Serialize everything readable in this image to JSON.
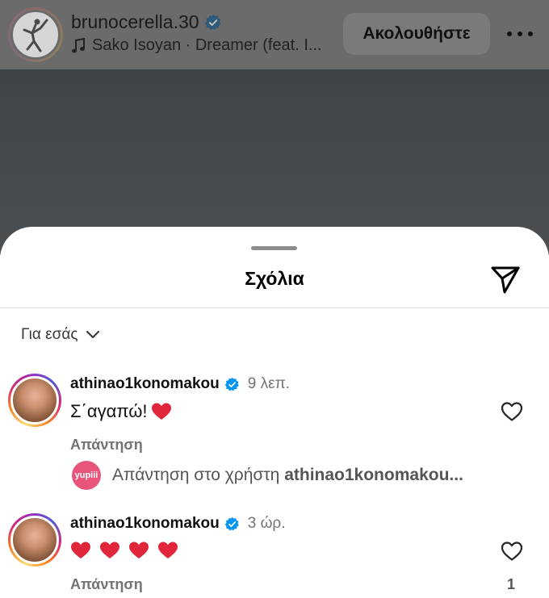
{
  "post": {
    "username": "brunocerella.30",
    "music": "Sako Isoyan · Dreamer (feat. I...",
    "follow_label": "Ακολουθήστε"
  },
  "sheet": {
    "title": "Σχόλια",
    "sort_label": "Για εσάς"
  },
  "comments": [
    {
      "username": "athinao1konomakou",
      "time": "9 λεπ.",
      "text": "Σ΄αγαπώ!",
      "hearts": 1,
      "reply_label": "Απάντηση",
      "likes": ""
    },
    {
      "username": "athinao1konomakou",
      "time": "3 ώρ.",
      "text": "",
      "hearts": 4,
      "reply_label": "Απάντηση",
      "likes": "1"
    }
  ],
  "reply_hint": {
    "logo_text": "yupiii",
    "prefix": "Απάντηση στο χρήστη",
    "target": "athinao1konomakou..."
  },
  "colors": {
    "verified": "#0095f6",
    "heart": "#e0263a",
    "muted_text": "#737373"
  },
  "icons": {
    "music": "music-note-icon",
    "share": "send-icon",
    "sort": "chevron-down-icon",
    "like": "heart-outline-icon",
    "verified": "verified-badge-icon"
  }
}
